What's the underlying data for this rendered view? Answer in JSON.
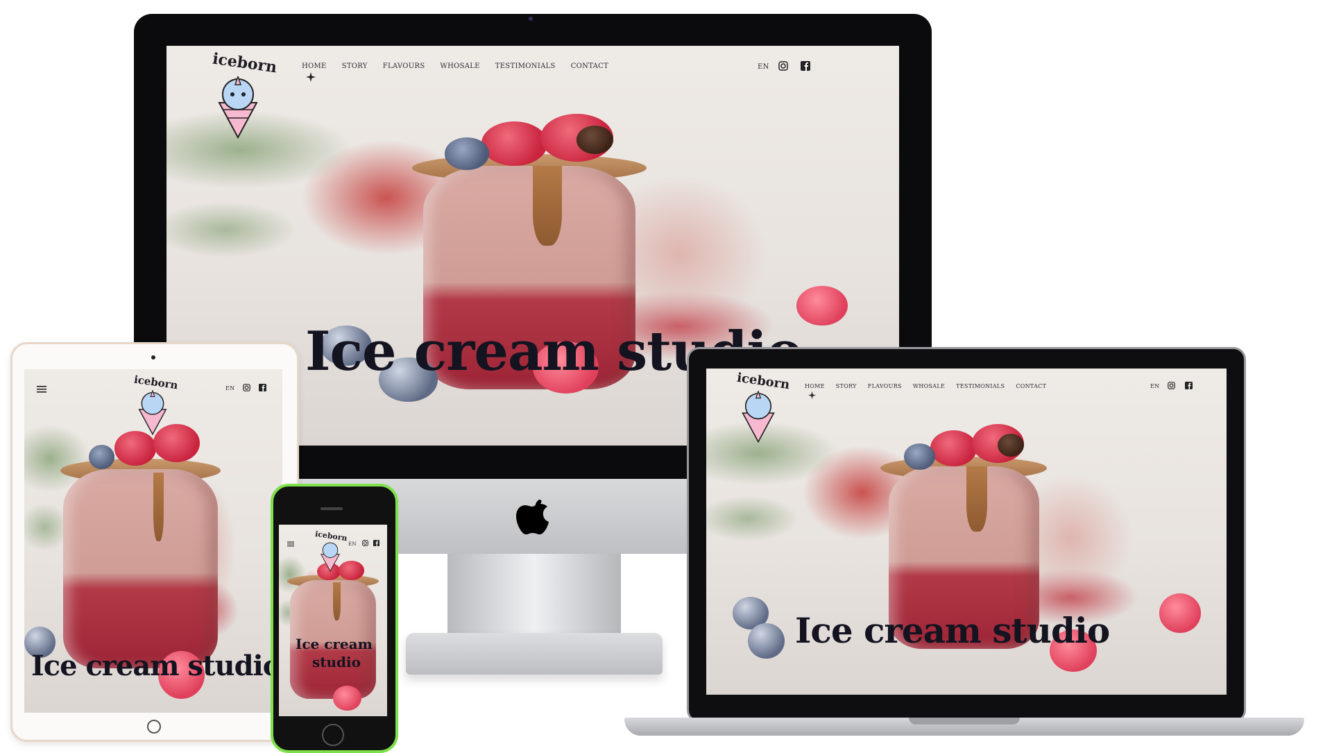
{
  "site": {
    "logo_text": "iceborn",
    "nav": [
      "HOME",
      "STORY",
      "FLAVOURS",
      "WHOSALE",
      "TESTIMONIALS",
      "CONTACT"
    ],
    "language": "EN",
    "headline": "Ice cream studio",
    "headline_mobile_line1": "Ice cream",
    "headline_mobile_line2": "studio",
    "icons": [
      "instagram-icon",
      "facebook-icon",
      "hamburger-menu-icon",
      "active-star-icon"
    ]
  },
  "devices": [
    "imac",
    "laptop",
    "tablet",
    "phone"
  ],
  "colors": {
    "headline": "#141320",
    "nav_text": "#2a2a33",
    "phone_frame": "#7ee04a",
    "raspberry": "#e0405c"
  }
}
